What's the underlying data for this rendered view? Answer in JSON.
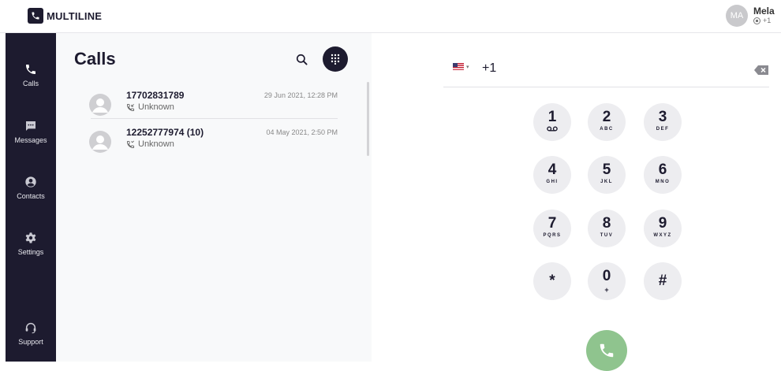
{
  "header": {
    "logo_text": "MULTILINE",
    "user": {
      "initials": "MA",
      "name": "Mela",
      "phone": "+1"
    }
  },
  "sidebar": {
    "items": [
      {
        "label": "Calls",
        "icon": "phone-icon"
      },
      {
        "label": "Messages",
        "icon": "message-icon"
      },
      {
        "label": "Contacts",
        "icon": "contact-icon"
      },
      {
        "label": "Settings",
        "icon": "gear-icon"
      },
      {
        "label": "Support",
        "icon": "headset-icon"
      }
    ]
  },
  "calls": {
    "title": "Calls",
    "items": [
      {
        "number": "17702831789",
        "status": "Unknown",
        "time": "29 Jun 2021, 12:28 PM"
      },
      {
        "number": "12252777974 (10)",
        "status": "Unknown",
        "time": "04 May 2021, 2:50 PM"
      }
    ]
  },
  "dialer": {
    "country_code": "+1",
    "keys": [
      {
        "digit": "1",
        "letters": ""
      },
      {
        "digit": "2",
        "letters": "ABC"
      },
      {
        "digit": "3",
        "letters": "DEF"
      },
      {
        "digit": "4",
        "letters": "GHI"
      },
      {
        "digit": "5",
        "letters": "JKL"
      },
      {
        "digit": "6",
        "letters": "MNO"
      },
      {
        "digit": "7",
        "letters": "PQRS"
      },
      {
        "digit": "8",
        "letters": "TUV"
      },
      {
        "digit": "9",
        "letters": "WXYZ"
      },
      {
        "digit": "*",
        "letters": ""
      },
      {
        "digit": "0",
        "letters": "+"
      },
      {
        "digit": "#",
        "letters": ""
      }
    ]
  },
  "colors": {
    "sidebar_bg": "#1d1b2f",
    "panel_bg": "#f8f9fa",
    "key_bg": "#ededf0",
    "call_button": "#8fc48e"
  }
}
